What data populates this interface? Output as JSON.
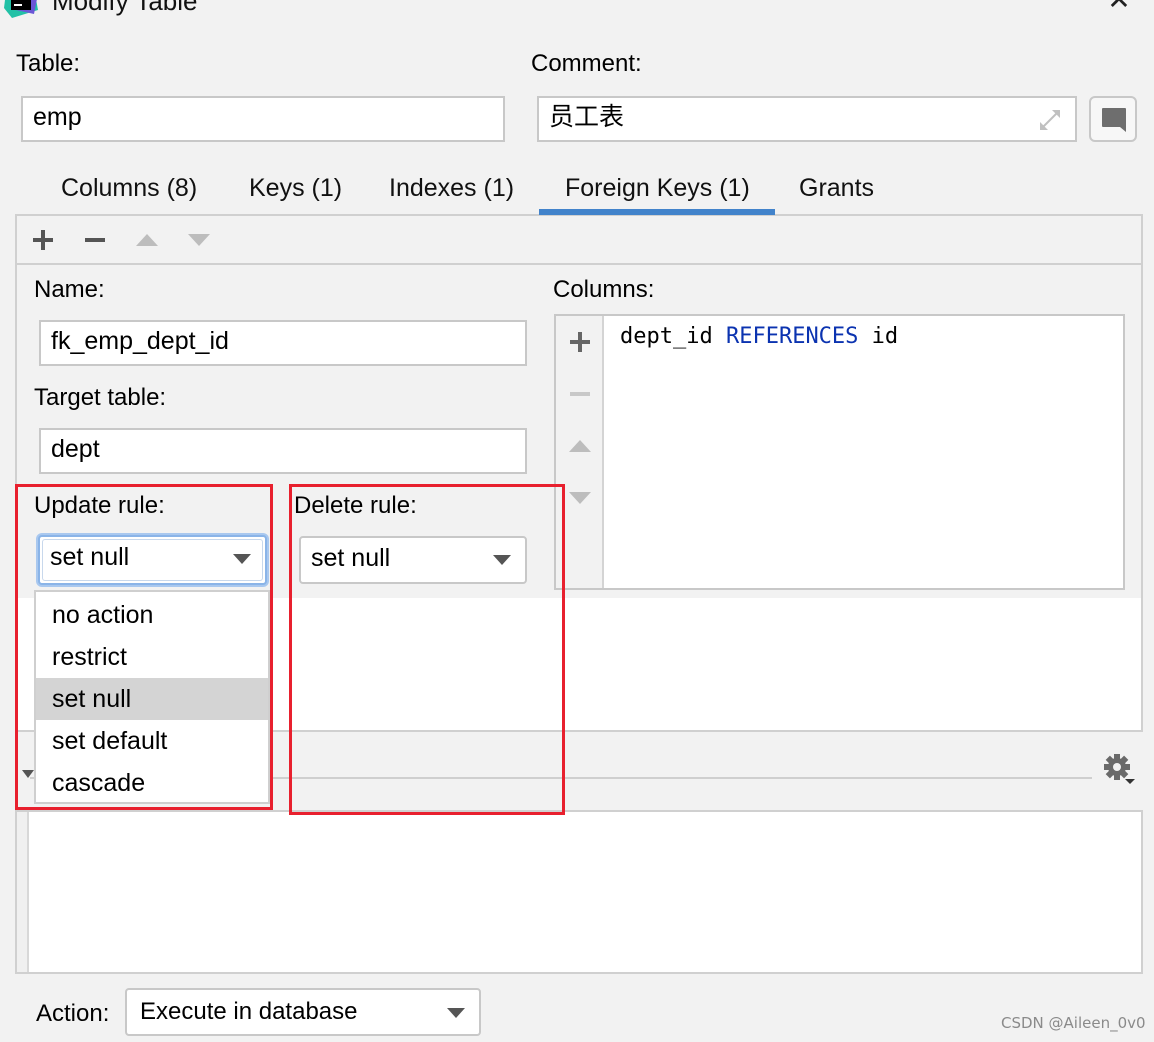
{
  "window": {
    "title": "Modify Table",
    "icons": {
      "logo": "datagrip-logo-icon",
      "close": "close-icon"
    },
    "close_glyph": "✕"
  },
  "header": {
    "table_label": "Table:",
    "table_value": "emp",
    "comment_label": "Comment:",
    "comment_value": "员工表",
    "icons": {
      "expand": "expand-icon",
      "comment": "comment-icon"
    }
  },
  "tabs": [
    {
      "label": "Columns (8)",
      "active": false
    },
    {
      "label": "Keys (1)",
      "active": false
    },
    {
      "label": "Indexes (1)",
      "active": false
    },
    {
      "label": "Foreign Keys (1)",
      "active": true
    },
    {
      "label": "Grants",
      "active": false
    }
  ],
  "toolbar": {
    "icons": [
      "plus-icon",
      "minus-icon",
      "move-up-icon",
      "move-down-icon"
    ]
  },
  "foreign_key": {
    "name_label": "Name:",
    "name_value": "fk_emp_dept_id",
    "target_label": "Target table:",
    "target_value": "dept",
    "update_rule_label": "Update rule:",
    "update_rule_value": "set null",
    "delete_rule_label": "Delete rule:",
    "delete_rule_value": "set null",
    "columns_label": "Columns:",
    "columns": [
      {
        "column": "dept_id",
        "keyword": "REFERENCES",
        "ref": "id"
      }
    ]
  },
  "update_rule_dropdown": {
    "options": [
      "no action",
      "restrict",
      "set null",
      "set default",
      "cascade"
    ],
    "selected": "set null"
  },
  "bottom": {
    "action_label": "Action:",
    "action_value": "Execute in database",
    "icons": {
      "settings": "gear-icon"
    }
  },
  "colors": {
    "accent": "#4283cb",
    "annotation_red": "#e8202e",
    "keyword_blue": "#0b33b0",
    "background": "#f2f2f2"
  },
  "watermark": "CSDN @Aileen_0v0"
}
